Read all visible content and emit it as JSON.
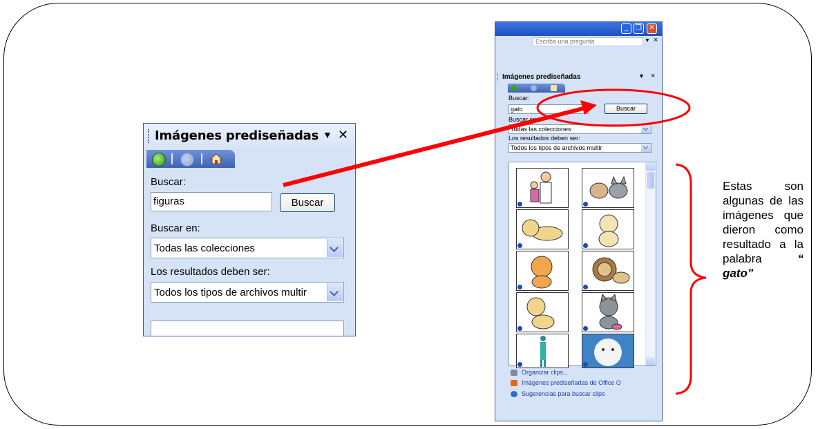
{
  "left_pane": {
    "title": "Imágenes prediseñadas",
    "dropdown_glyph": "▼",
    "close_glyph": "✕",
    "nav_icons": [
      "back-icon",
      "forward-icon",
      "home-icon"
    ],
    "search_label": "Buscar:",
    "search_value": "figuras",
    "search_button": "Buscar",
    "search_in_label": "Buscar en:",
    "search_in_value": "Todas las colecciones",
    "results_label": "Los resultados deben ser:",
    "results_value": "Todos los tipos de archivos multir"
  },
  "right_pane": {
    "window_buttons": {
      "minimize": "_",
      "maximize": "❐",
      "close": "✕"
    },
    "ask_placeholder": "Escriba una pregunta",
    "ask_close": "×",
    "title": "Imágenes prediseñadas",
    "dropdown_glyph": "▼",
    "close_glyph": "×",
    "search_label": "Buscar:",
    "search_value": "gato",
    "search_button": "Buscar",
    "search_in_label": "Buscar en:",
    "search_in_value": "Todas las colecciones",
    "results_label": "Los resultados deben ser:",
    "results_value": "Todos los tipos de archivos multir",
    "thumbnails": [
      "doctor-with-child",
      "dog-and-cat",
      "leopard-cub",
      "leopard-sitting",
      "tiger-cub",
      "lion",
      "leopard-sitting-2",
      "gray-cat",
      "woman-figure",
      "white-tiger"
    ],
    "links": [
      "Organizar clips...",
      "Imágenes prediseñadas de Office O",
      "Sugerencias para buscar clips"
    ]
  },
  "annotation": {
    "text": "Estas son algunas de las imágenes que dieron como resultado a la palabra",
    "emphasis": "“ gato”"
  },
  "colors": {
    "annotation": "#ff0000",
    "pane": "#d6e3f7",
    "titlebar": "#1f50c4"
  }
}
